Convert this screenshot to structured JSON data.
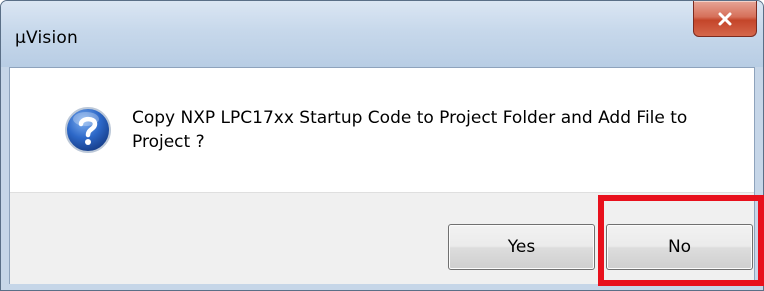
{
  "window": {
    "title": "µVision"
  },
  "dialog": {
    "icon": "question-icon",
    "message": "Copy NXP LPC17xx Startup Code to Project Folder and Add File to Project ?"
  },
  "buttons": {
    "yes_label": "Yes",
    "no_label": "No"
  },
  "colors": {
    "highlight": "#e8101c",
    "close_button": "#c4452a",
    "titlebar": "#c7d8eb"
  },
  "annotation": {
    "highlighted_element": "no-button"
  }
}
